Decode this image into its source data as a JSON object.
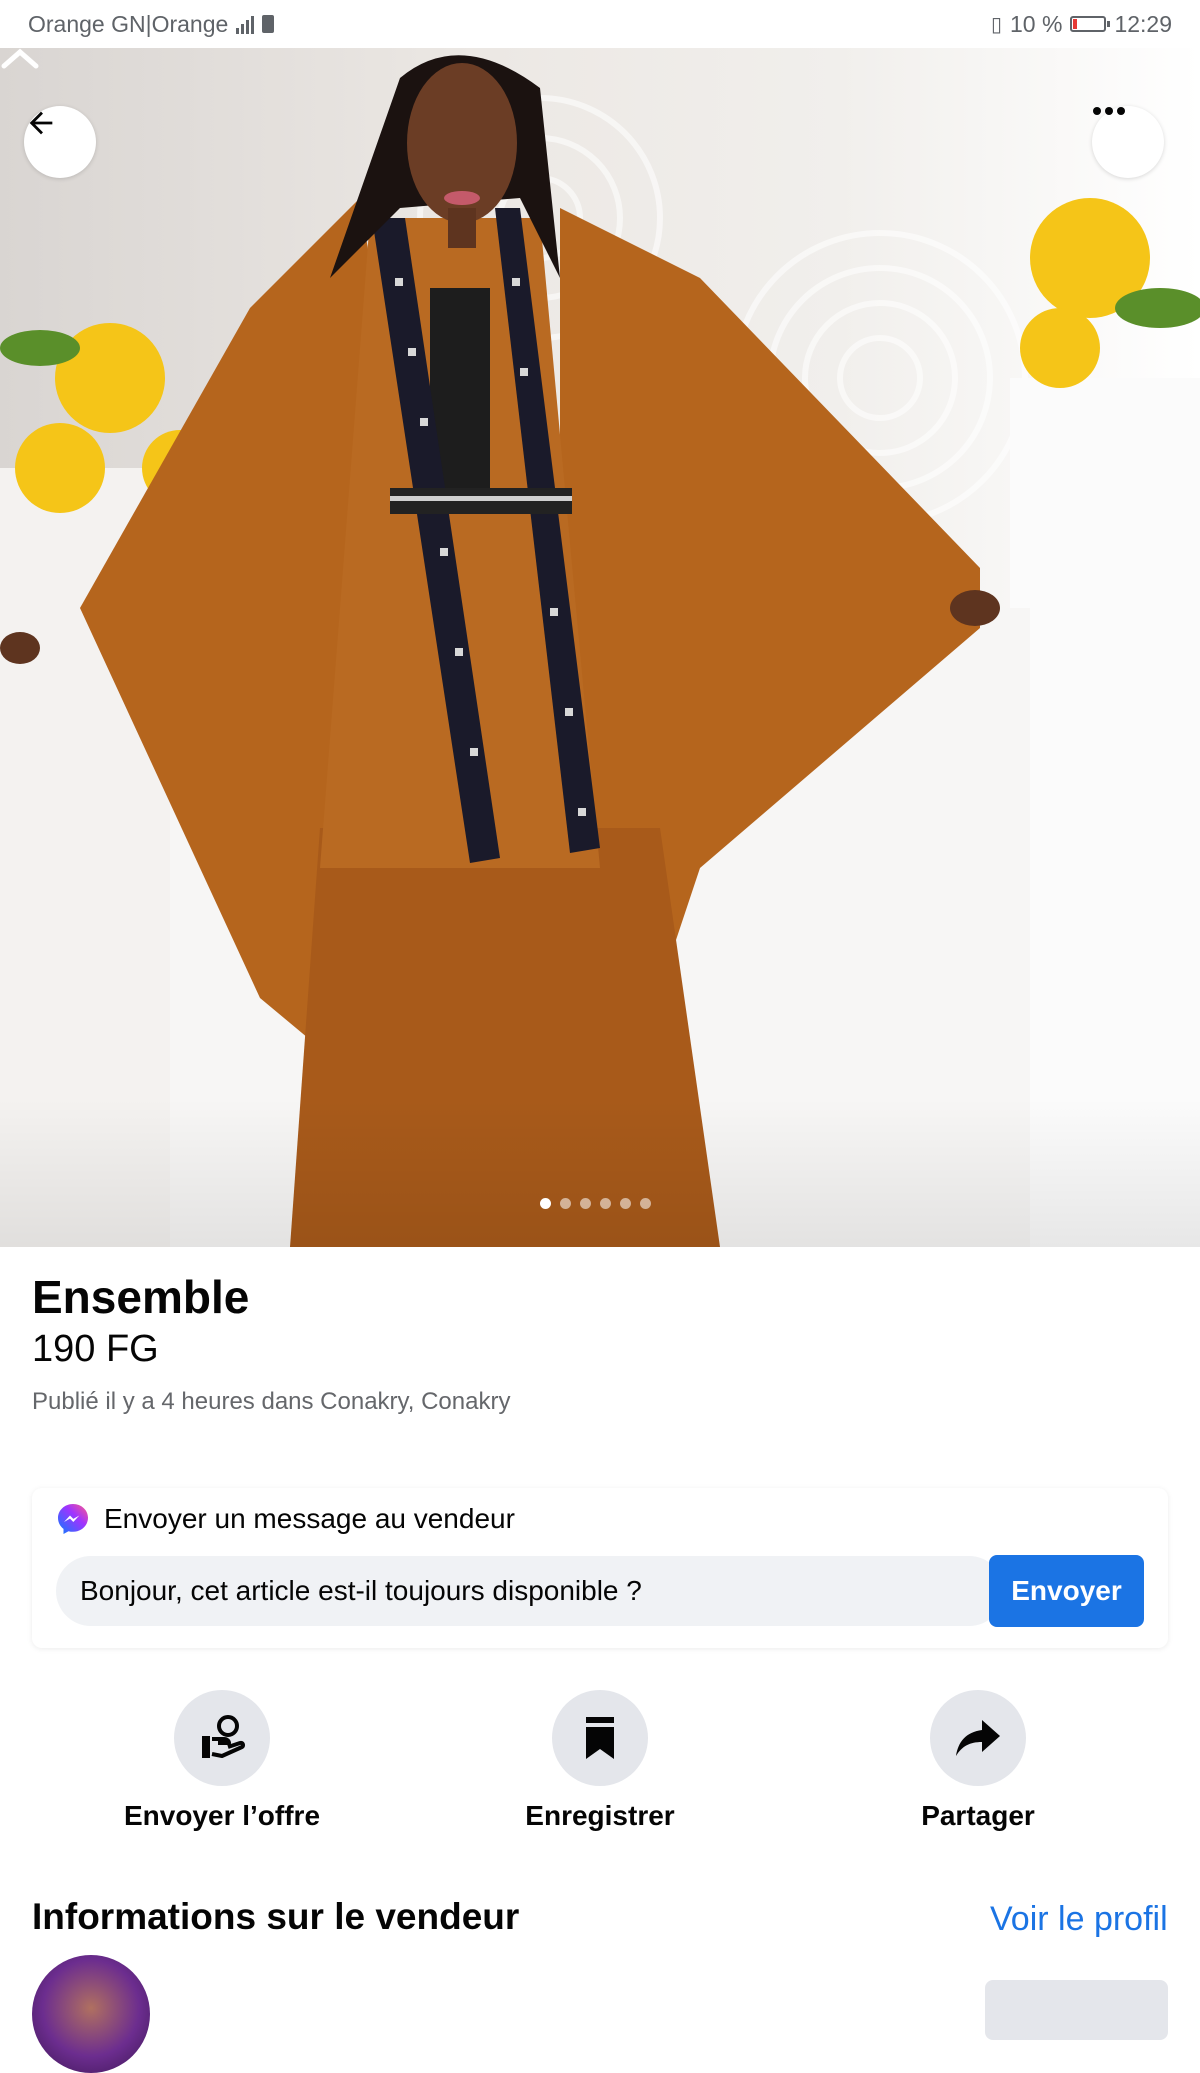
{
  "status_bar": {
    "carrier": "Orange GN|Orange",
    "battery_percent": "10 %",
    "time": "12:29"
  },
  "listing": {
    "title": "Ensemble",
    "price": "190 FG",
    "meta": "Publié il y a 4 heures dans Conakry, Conakry",
    "photo_count": 6,
    "active_photo_index": 0
  },
  "message_box": {
    "heading": "Envoyer un message au vendeur",
    "input_value": "Bonjour, cet article est-il toujours disponible ?",
    "send_label": "Envoyer"
  },
  "actions": [
    {
      "label": "Envoyer l’offre",
      "icon": "offer-hand-icon"
    },
    {
      "label": "Enregistrer",
      "icon": "bookmark-icon"
    },
    {
      "label": "Partager",
      "icon": "share-icon"
    }
  ],
  "seller": {
    "heading": "Informations sur le vendeur",
    "profile_link": "Voir le profil"
  },
  "colors": {
    "accent": "#1b74e4",
    "garment": "#b5651d"
  }
}
